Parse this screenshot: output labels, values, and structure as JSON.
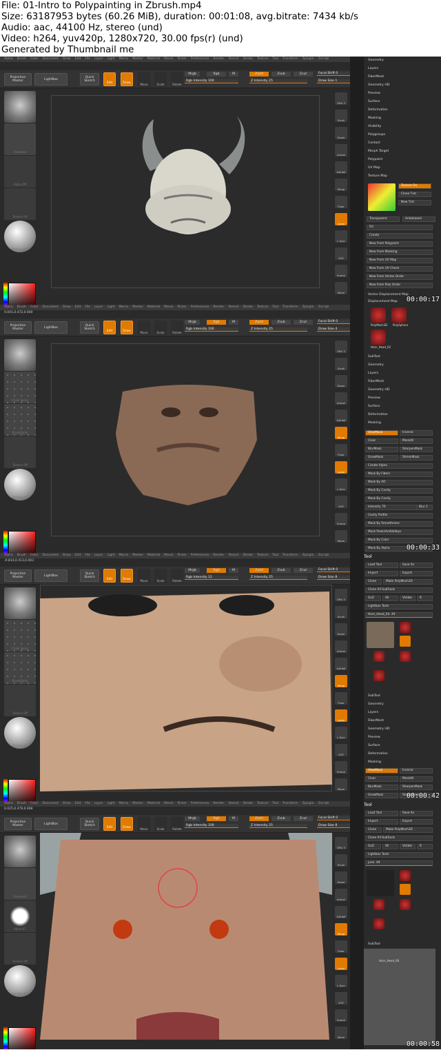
{
  "header": {
    "line1": "File: 01-Intro to Polypainting in Zbrush.mp4",
    "line2": "Size: 63187953 bytes (60.26 MiB), duration: 00:01:08, avg.bitrate: 7434 kb/s",
    "line3": "Audio: aac, 44100 Hz, stereo (und)",
    "line4": "Video: h264, yuv420p, 1280x720, 30.00 fps(r) (und)",
    "line5": "Generated by Thumbnail me"
  },
  "menu": [
    "Alpha",
    "Brush",
    "Color",
    "Document",
    "Draw",
    "Edit",
    "File",
    "Layer",
    "Light",
    "Macro",
    "Marker",
    "Material",
    "Movie",
    "Picker",
    "Preferences",
    "Render",
    "Stencil",
    "Stroke",
    "Texture",
    "Tool",
    "Transform",
    "Zplugin",
    "Zscript"
  ],
  "toolbar": {
    "projection": "Projection Master",
    "lightbox": "LightBox",
    "quicksketch": "Quick Sketch",
    "edit": "Edit",
    "draw": "Draw",
    "move": "Move",
    "scale": "Scale",
    "rotate": "Rotate",
    "mrgb": "Mrgb",
    "rgb": "Rgb",
    "m": "M",
    "zadd": "Zadd",
    "zsub": "Zsub",
    "zcut": "Zcut",
    "focal": "Focal Shift 0",
    "zintensity": "Z Intensity 25"
  },
  "frames": [
    {
      "timestamp": "00:00:17",
      "coords": "",
      "rgb_intensity": "Rgb Intensity 100",
      "draw_size": "Draw Size 1",
      "left_labels": [
        "Standard",
        "FreeHand",
        "Alpha Off",
        "Texture Off",
        "MatCap Red"
      ],
      "gradient": "Gradient",
      "tray_rows": [
        "Geometry",
        "Layers",
        "FiberMesh",
        "Geometry HD",
        "Preview",
        "Surface",
        "Deformation",
        "Masking",
        "Visibility",
        "Polygroups",
        "Contact",
        "Morph Target",
        "Polypaint",
        "UV Map",
        "Texture Map"
      ],
      "texmap": {
        "on": "Texture On",
        "clone": "Clone Txtr",
        "new": "New Txtr",
        "transparent": "Transparent",
        "antialiased": "Antialiased",
        "fill": "Fill",
        "create": "Create"
      },
      "create_items": [
        "New From Polypaint",
        "New From Masking",
        "New From UV Map",
        "New From UV Check",
        "New From Vertex Order",
        "New From Poly Order"
      ],
      "bottom_rows": [
        "Vector Displacement Map",
        "Displacement Map"
      ]
    },
    {
      "timestamp": "00:00:33",
      "coords": "0.041,0.472,0.000",
      "rgb_intensity": "Rgb Intensity 100",
      "draw_size": "Draw Size 4",
      "left_labels": [
        "Standard",
        "Chalk Spray",
        "BrushAlpha",
        "Texture Off",
        "SkinShade4"
      ],
      "gradient": "Gradient",
      "tools": [
        "PolyMesh3D",
        "PolySphere",
        "Horn_Head_02"
      ],
      "tray_rows": [
        "SubTool",
        "Geometry",
        "Layers",
        "FiberMesh",
        "Geometry HD",
        "Preview",
        "Surface",
        "Deformation",
        "Masking"
      ],
      "mask_btns": [
        "ViewMask",
        "Inverse",
        "Clear",
        "MaskAll",
        "BlurMask",
        "SharpenMask",
        "GrowMask",
        "ShrinkMask"
      ],
      "mask_items": [
        "Create Alpha",
        "Mask By Fibers",
        "Mask By AO",
        "Mask By Cavity",
        "Mask By Cavity",
        "Intensity 70",
        "Cavity Profile",
        "Mask By Smoothness",
        "Mask PeaksAndValleys",
        "Mask By Color",
        "Mask By Alpha",
        "Apply"
      ],
      "blur": "Blur 2"
    },
    {
      "timestamp": "00:00:42",
      "coords": "-0.814,0.413,0.003",
      "rgb_intensity": "Rgb Intensity 12",
      "draw_size": "Draw Size 8",
      "left_labels": [
        "Standard",
        "Chalk Spray",
        "BrushAlpha",
        "Texture Off",
        "SkinShade4"
      ],
      "gradient": "Gradient",
      "tool_title": "Tool",
      "tool_btns": [
        "Load Tool",
        "Save As",
        "Import",
        "Export",
        "Clone",
        "Make PolyMesh3D",
        "Clone All SubTools",
        "GoZ",
        "All",
        "Visible",
        "R",
        "Lightbox Tools"
      ],
      "tool_name": "Horn_Head_04. 49",
      "tools": [
        "SphereB3D",
        "SimpleBrush",
        "PolyMesh3D",
        "PolySphere",
        "Horn_Head_04"
      ],
      "tray_rows": [
        "SubTool",
        "Geometry",
        "Layers",
        "FiberMesh",
        "Geometry HD",
        "Preview",
        "Surface",
        "Deformation",
        "Masking"
      ],
      "mask_btns": [
        "ViewMask",
        "Inverse",
        "Clear",
        "MaskAll",
        "BlurMask",
        "SharpenMask",
        "GrowMask",
        "ShrinkMask"
      ]
    },
    {
      "timestamp": "00:00:58",
      "coords": "0.025,0.479,0.068",
      "rgb_intensity": "Rgb Intensity 100",
      "draw_size": "Draw Size 8",
      "left_labels": [
        "Standard",
        "FreeHand",
        "Alpha 07",
        "Texture Off",
        "SkinShade4"
      ],
      "gradient": "Gradient",
      "tool_title": "Tool",
      "tool_btns": [
        "Load Tool",
        "Save As",
        "Import",
        "Export",
        "Clone",
        "Make PolyMesh3D",
        "Clone All SubTools",
        "GoZ",
        "All",
        "Visible",
        "R",
        "Lightbox Tools"
      ],
      "tool_name": "junk. 49",
      "tools": [
        "SphereB3D",
        "SimpleBrush",
        "PolyMesh3D",
        "PolySphere",
        "junk"
      ],
      "subtool_title": "SubTool",
      "subtool_item": "Horn_Head_06"
    }
  ],
  "shelf": [
    "SPix 3",
    "Scroll",
    "Zoom",
    "Actual",
    "AAHalf",
    "Persp",
    "Floor",
    "Local",
    "L.Sym",
    "XYZ",
    "Frame",
    "Move"
  ],
  "colors": {
    "accent": "#e07a00",
    "bg": "#2a2a2a",
    "panel": "#333333"
  }
}
